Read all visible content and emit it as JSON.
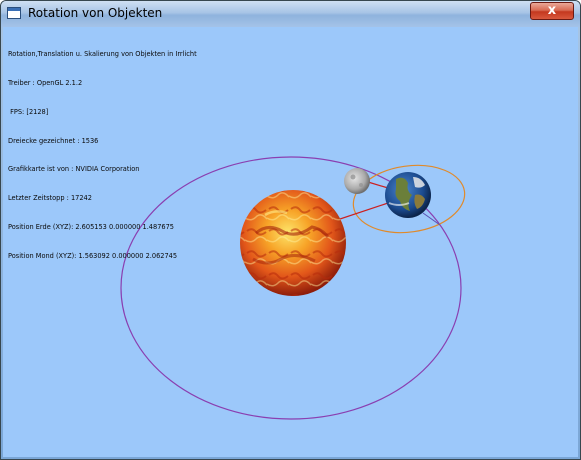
{
  "window": {
    "title": "Rotation von Objekten",
    "close_glyph": "x"
  },
  "info": {
    "lines": [
      "Rotation,Translation u. Skalierung von Objekten in Irrlicht",
      "Treiber : OpenGL 2.1.2",
      " FPS: [2128]",
      "Dreiecke gezeichnet : 1536",
      "Grafikkarte ist von : NVIDIA Corporation",
      "Letzter Zeitstopp : 17242",
      "Position Erde (XYZ): 2.605153 0.000000 1.487675",
      "Position Mond (XYZ): 1.563092 0.000000 2.062745"
    ]
  },
  "colors": {
    "background": "#9cc8fa",
    "earth_orbit": "#8a3fb0",
    "moon_orbit": "#e08a2a",
    "connector": "#cc1f1f",
    "sun": "#f07a18",
    "earth": "#1f4f9a",
    "moon": "#b8b8b8"
  },
  "icons": {
    "app": "window-icon",
    "close": "close-icon"
  }
}
